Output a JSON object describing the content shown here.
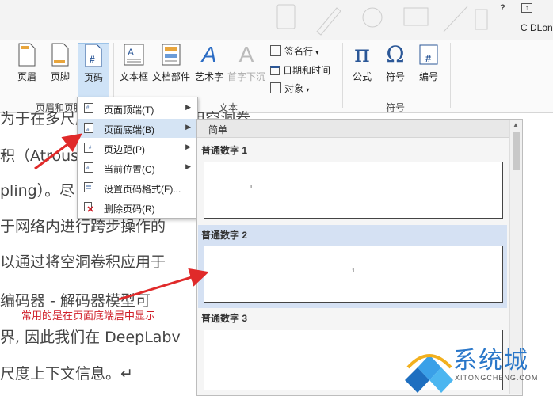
{
  "titlebar": {
    "help": "?",
    "user": "C DLon"
  },
  "ribbon": {
    "groups": {
      "header_footer": "页眉和页脚",
      "text": "文本",
      "symbols": "符号"
    },
    "buttons": {
      "header": "页眉",
      "footer": "页脚",
      "page_number": "页码",
      "textbox": "文本框",
      "quick_parts": "文档部件",
      "wordart": "艺术字",
      "dropcap": "首字下沉",
      "signature_line": "签名行",
      "date_time": "日期和时间",
      "object": "对象",
      "equation": "公式",
      "symbol": "符号",
      "numbering": "编号"
    },
    "glyphs": {
      "page_number": "#",
      "equation": "π",
      "symbol": "Ω",
      "numbering": "#",
      "wordart": "A",
      "dropcap": "A"
    }
  },
  "document": {
    "lines": [
      "为于在多尺度上下文信息, 应用空洞卷",
      "积（Atrous (",
      "pling）。尽",
      "于网络内进行跨步操作的",
      "以通过将空洞卷积应用于",
      "编码器 - 解码器模型可",
      "界, 因此我们在 DeepLabv",
      "尺度上下文信息。↵"
    ]
  },
  "menu": {
    "items": [
      {
        "label": "页面顶端(T)",
        "has_arrow": true,
        "selected": false
      },
      {
        "label": "页面底端(B)",
        "has_arrow": true,
        "selected": true
      },
      {
        "label": "页边距(P)",
        "has_arrow": true,
        "selected": false
      },
      {
        "label": "当前位置(C)",
        "has_arrow": true,
        "selected": false
      },
      {
        "label": "设置页码格式(F)...",
        "has_arrow": false,
        "selected": false
      },
      {
        "label": "删除页码(R)",
        "has_arrow": false,
        "selected": false
      }
    ],
    "arrow_glyph": "▶"
  },
  "gallery": {
    "header": "简单",
    "items": [
      {
        "label": "普通数字 1",
        "number": "1"
      },
      {
        "label": "普通数字 2",
        "number": "1"
      },
      {
        "label": "普通数字 3",
        "number": ""
      }
    ]
  },
  "annotation": "常用的是在页面底端居中显示",
  "watermark": {
    "text": "系统城",
    "sub": "XITONGCHENG.COM"
  },
  "colors": {
    "accent": "#2b5797",
    "selected": "#d5e4f4",
    "annotation": "#d0202a",
    "watermark": "#2a77c9"
  }
}
